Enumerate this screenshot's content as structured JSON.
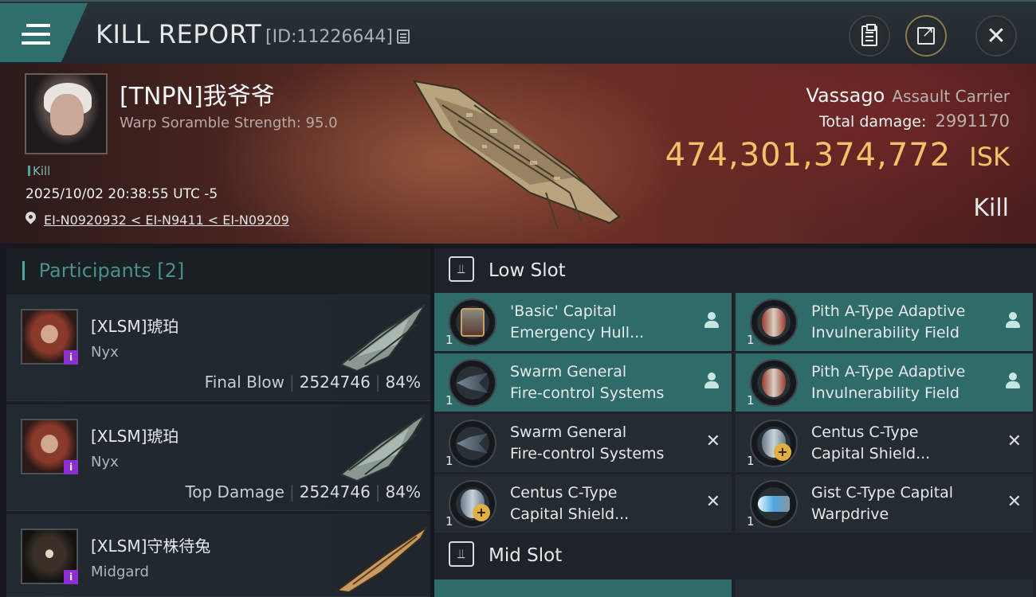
{
  "header": {
    "title": "KILL REPORT",
    "report_id": "[ID:11226644]"
  },
  "victim": {
    "name": "[TNPN]我爷爷",
    "warp_scramble": "Warp Soramble Strength: 95.0",
    "tag": "Kill",
    "time": "2025/10/02 20:38:55 UTC -5",
    "location": "EI-N0920932 < EI-N9411 < EI-N09209",
    "ship_name": "Vassago",
    "ship_class": "Assault Carrier",
    "total_damage_label": "Total damage:",
    "total_damage_value": "2991170",
    "isk_value": "474,301,374,772",
    "isk_unit": "ISK",
    "result": "Kill"
  },
  "participants": {
    "label": "Participants",
    "count": "[2]",
    "rows": [
      {
        "name": "[XLSM]琥珀",
        "ship": "Nyx",
        "role": "Final Blow",
        "damage": "2524746",
        "percent": "84%"
      },
      {
        "name": "[XLSM]琥珀",
        "ship": "Nyx",
        "role": "Top Damage",
        "damage": "2524746",
        "percent": "84%"
      },
      {
        "name": "[XLSM]守株待兔",
        "ship": "Midgard"
      }
    ]
  },
  "fitting": {
    "low_slot_label": "Low Slot",
    "mid_slot_label": "Mid Slot",
    "modules": [
      {
        "line1": "'Basic' Capital",
        "line2": "Emergency Hull...",
        "qty": "1",
        "state": "pilot",
        "icon": "hull-repairer-icon"
      },
      {
        "line1": "Pith A-Type Adaptive",
        "line2": "Invulnerability Field",
        "qty": "1",
        "state": "pilot",
        "icon": "invulnerability-field-icon"
      },
      {
        "line1": "Swarm General",
        "line2": "Fire-control Systems",
        "qty": "1",
        "state": "pilot",
        "icon": "fire-control-icon"
      },
      {
        "line1": "Pith A-Type Adaptive",
        "line2": "Invulnerability Field",
        "qty": "1",
        "state": "pilot",
        "icon": "invulnerability-field-icon"
      },
      {
        "line1": "Swarm General",
        "line2": "Fire-control Systems",
        "qty": "1",
        "state": "destroyed",
        "icon": "fire-control-icon"
      },
      {
        "line1": "Centus C-Type",
        "line2": "Capital Shield...",
        "qty": "1",
        "state": "destroyed",
        "icon": "shield-booster-icon"
      },
      {
        "line1": "Centus C-Type",
        "line2": "Capital Shield...",
        "qty": "1",
        "state": "destroyed",
        "icon": "shield-booster-icon"
      },
      {
        "line1": "Gist C-Type Capital",
        "line2": "Warpdrive",
        "qty": "1",
        "state": "destroyed",
        "icon": "warpdrive-icon"
      }
    ]
  },
  "colors": {
    "accent": "#2f6b68",
    "isk": "#f0c36a",
    "corp_badge": "#8d2fd0"
  }
}
